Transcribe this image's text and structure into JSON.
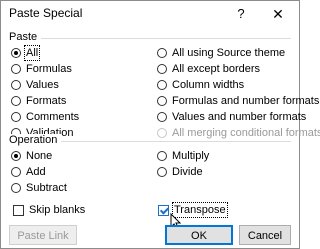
{
  "window": {
    "title": "Paste Special",
    "help_icon": "?",
    "close_icon": "✕"
  },
  "paste_group": {
    "label": "Paste",
    "left_options": [
      "All",
      "Formulas",
      "Values",
      "Formats",
      "Comments",
      "Validation"
    ],
    "right_options": [
      "All using Source theme",
      "All except borders",
      "Column widths",
      "Formulas and number formats",
      "Values and number formats",
      "All merging conditional formats"
    ],
    "selected": "All",
    "disabled": [
      "All merging conditional formats"
    ]
  },
  "operation_group": {
    "label": "Operation",
    "left_options": [
      "None",
      "Add",
      "Subtract"
    ],
    "right_options": [
      "Multiply",
      "Divide"
    ],
    "selected": "None"
  },
  "checkboxes": {
    "skip_blanks": {
      "label": "Skip blanks",
      "checked": false
    },
    "transpose": {
      "label": "Transpose",
      "checked": true
    }
  },
  "buttons": {
    "paste_link": "Paste Link",
    "ok": "OK",
    "cancel": "Cancel"
  }
}
